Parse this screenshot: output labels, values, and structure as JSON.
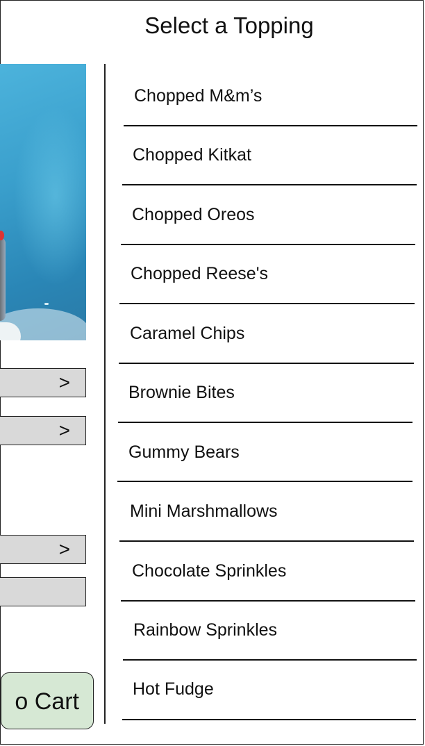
{
  "header": {
    "title": "Select a Topping"
  },
  "sidebar": {
    "buttons": [
      {
        "label": ">"
      },
      {
        "label": ">"
      },
      {
        "label": ">"
      },
      {
        "label": ""
      }
    ],
    "cart_label": "o Cart"
  },
  "toppings": [
    "Chopped M&m’s",
    "Chopped Kitkat",
    "Chopped Oreos",
    "Chopped Reese's",
    "Caramel Chips",
    "Brownie Bites",
    "Gummy Bears",
    "Mini Marshmallows",
    "Chocolate Sprinkles",
    "Rainbow Sprinkles",
    "Hot Fudge"
  ]
}
